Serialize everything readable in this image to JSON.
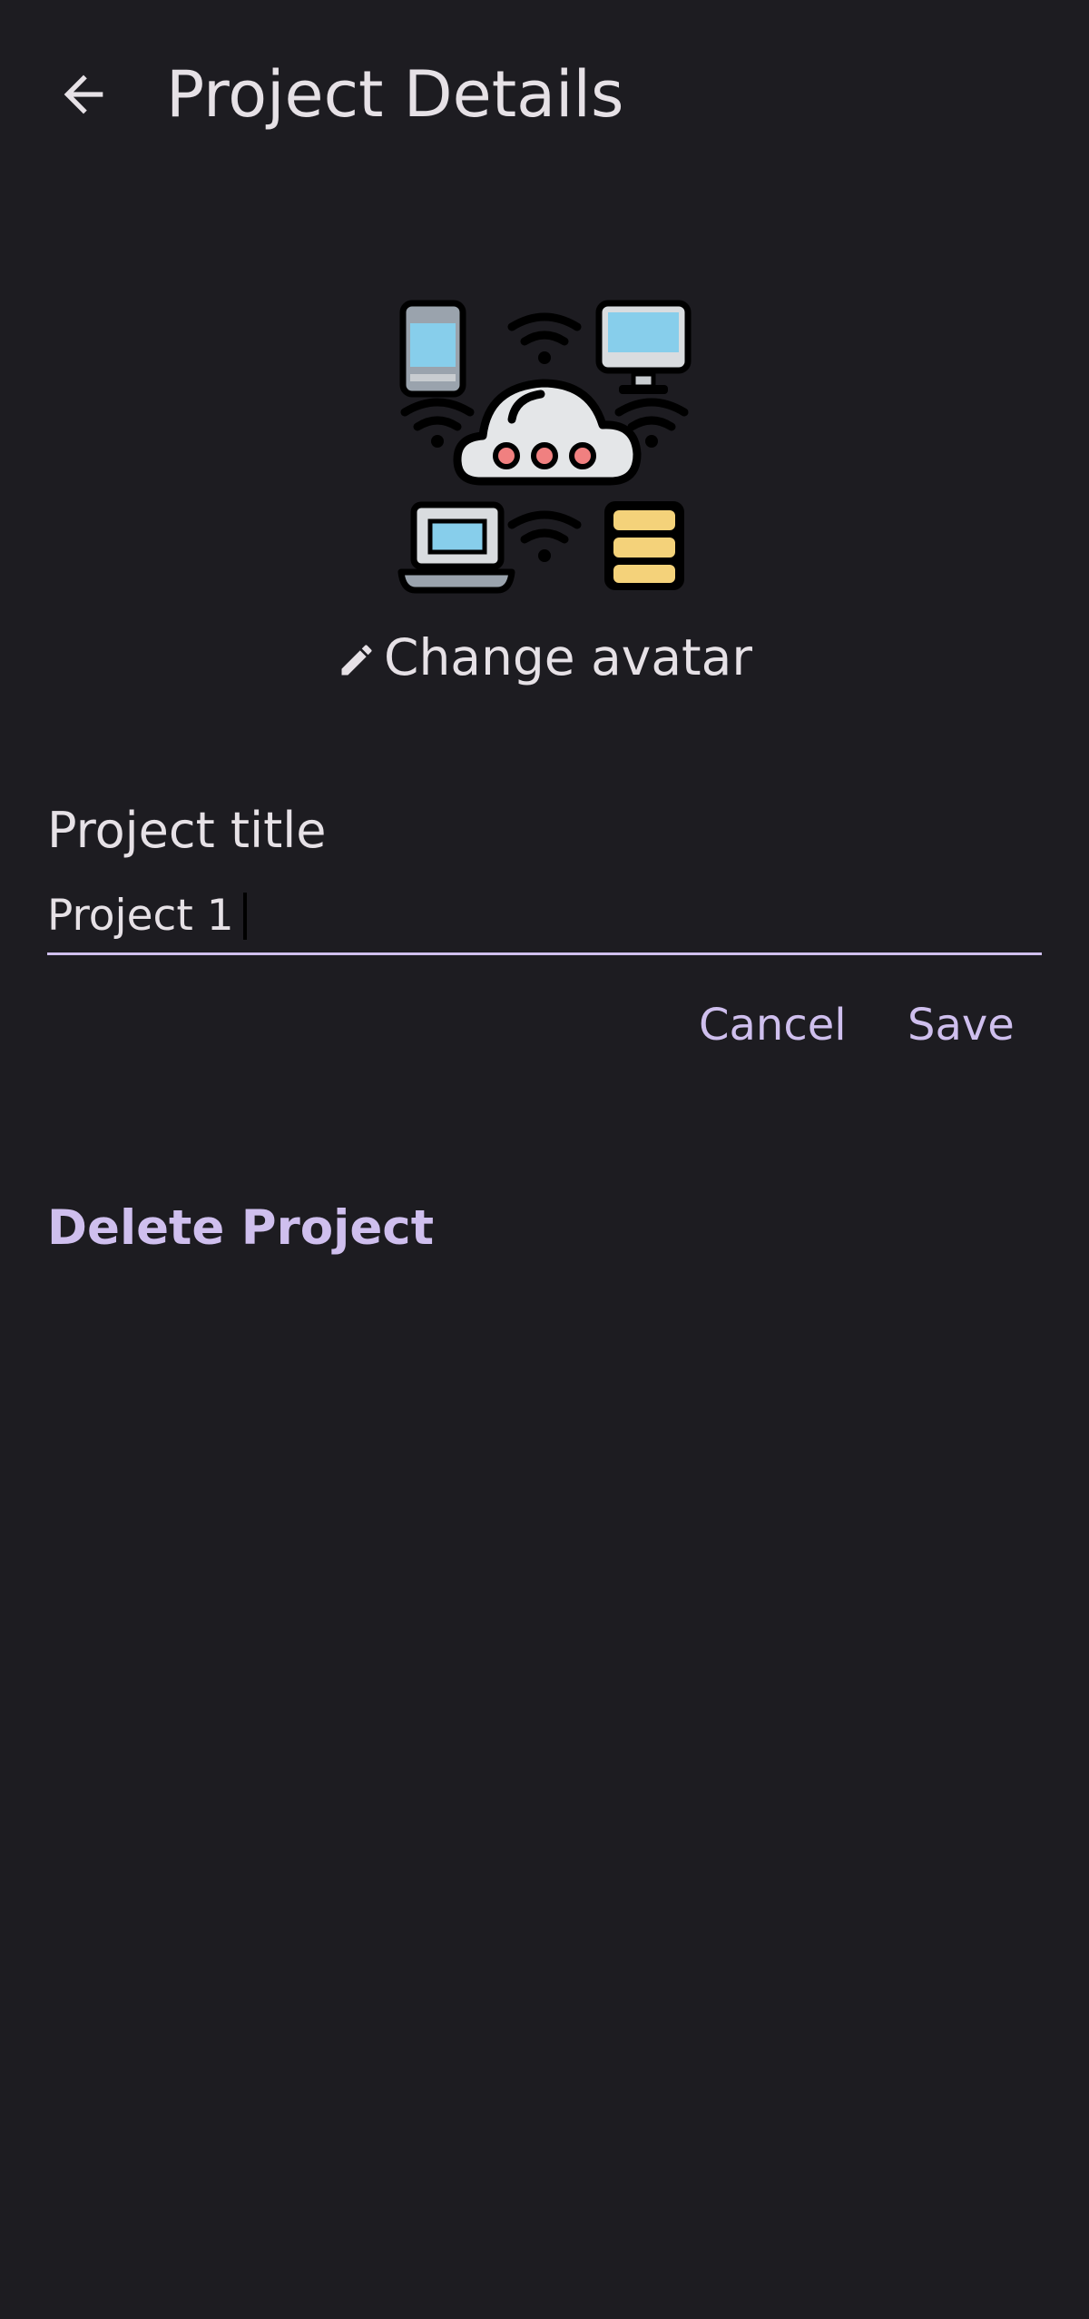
{
  "header": {
    "title": "Project Details",
    "back_icon": "arrow-back-icon"
  },
  "avatar": {
    "icon": "cloud-network-devices-icon",
    "change_label": "Change avatar",
    "change_icon": "pencil-icon"
  },
  "form": {
    "title_label": "Project title",
    "title_value": "Project 1",
    "cancel_label": "Cancel",
    "save_label": "Save"
  },
  "danger": {
    "delete_label": "Delete Project"
  },
  "colors": {
    "background": "#1d1c21",
    "text": "#e6e1e6",
    "accent": "#cfbfee"
  }
}
